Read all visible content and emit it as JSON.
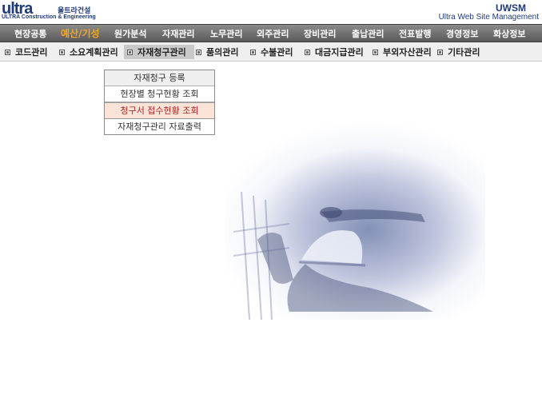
{
  "header": {
    "logo_main": "ultra",
    "logo_korean": "울트라건설",
    "logo_sub": "ULTRA Construction & Engineering",
    "brand_short": "UWSM",
    "brand_full": "Ultra Web Site Management"
  },
  "main_nav": {
    "items": [
      {
        "label": "현장공통"
      },
      {
        "label": "예산/기성",
        "active": true
      },
      {
        "label": "원가분석"
      },
      {
        "label": "자재관리"
      },
      {
        "label": "노무관리"
      },
      {
        "label": "외주관리"
      },
      {
        "label": "장비관리"
      },
      {
        "label": "출납관리"
      },
      {
        "label": "전표발행"
      },
      {
        "label": "경영정보"
      },
      {
        "label": "화상정보"
      }
    ]
  },
  "sub_nav": {
    "items": [
      {
        "label": "코드관리"
      },
      {
        "label": "소요계획관리"
      },
      {
        "label": "자재청구관리",
        "active": true
      },
      {
        "label": "품의관리"
      },
      {
        "label": "수불관리"
      },
      {
        "label": "대금지급관리"
      },
      {
        "label": "부외자산관리"
      },
      {
        "label": "기타관리"
      }
    ]
  },
  "dropdown": {
    "items": [
      {
        "label": "자재청구 등록"
      },
      {
        "label": "현장별 청구현황 조회"
      },
      {
        "label": "청구서 접수현황 조회",
        "highlighted": true
      },
      {
        "label": "자재청구관리 자료출력"
      }
    ]
  },
  "colors": {
    "brand_blue": "#1f3b7a",
    "active_menu": "#f5a623",
    "highlight_bg": "#fbe3d7",
    "highlight_text": "#b22222"
  }
}
